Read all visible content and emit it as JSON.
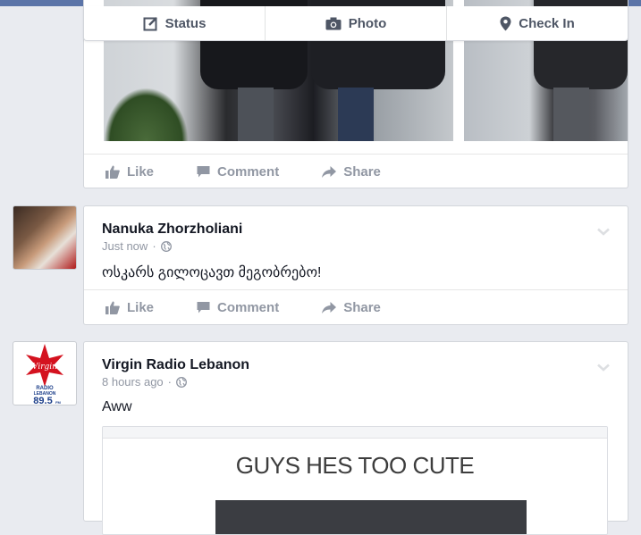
{
  "composer": {
    "status_label": "Status",
    "photo_label": "Photo",
    "checkin_label": "Check In"
  },
  "post_actions": {
    "like": "Like",
    "comment": "Comment",
    "share": "Share"
  },
  "posts": [
    {
      "author": "Nanuka Zhorzholiani",
      "time": "Just now",
      "separator": "·",
      "text": "ოსკარს გილოცავთ მეგობრებო!"
    },
    {
      "author": "Virgin Radio Lebanon",
      "time": "8 hours ago",
      "separator": "·",
      "text": "Aww",
      "shared_image_text": "GUYS HES TOO CUTE"
    }
  ],
  "virgin_logo": {
    "brand": "Virgin",
    "radio": "RADIO",
    "location": "LEBANON",
    "frequency": "89.5",
    "unit": "FM"
  },
  "colors": {
    "topbar": "#5b74a8",
    "background": "#e9ebf0",
    "action_text": "#9197a3",
    "virgin_red": "#d4121f"
  }
}
